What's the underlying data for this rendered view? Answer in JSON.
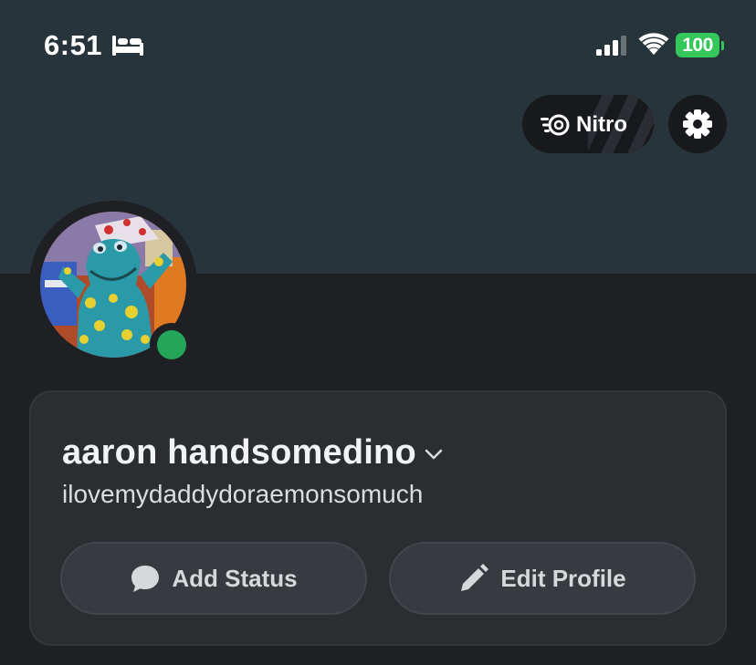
{
  "status_bar": {
    "time": "6:51",
    "battery": "100",
    "icons": [
      "bed-icon",
      "cellular-signal-icon",
      "wifi-icon",
      "battery-icon"
    ]
  },
  "header": {
    "nitro_label": "Nitro",
    "nitro_icon": "nitro-icon",
    "settings_icon": "gear-icon"
  },
  "profile": {
    "display_name": "aaron handsomedino",
    "username": "ilovemydaddydoraemonsomuch",
    "presence": "online",
    "presence_color": "#23a55a",
    "avatar_icon": "avatar"
  },
  "actions": {
    "add_status_label": "Add Status",
    "add_status_icon": "speech-bubble-icon",
    "edit_profile_label": "Edit Profile",
    "edit_profile_icon": "pencil-icon"
  },
  "colors": {
    "banner": "#28343b",
    "background": "#1f2024",
    "card": "#2b2d31",
    "button": "#383a40",
    "battery": "#34c759"
  }
}
